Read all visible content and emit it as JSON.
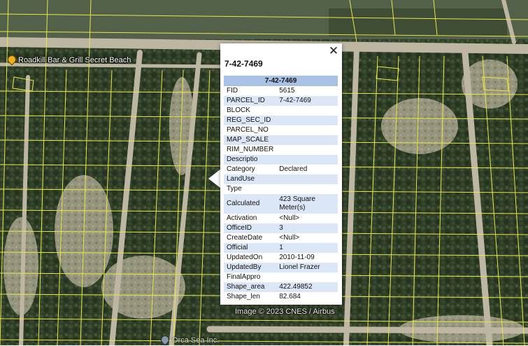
{
  "map": {
    "poi_label": "Roadkill Bar & Grill Secret Beach",
    "bottom_label": "Orca Sea Inc.",
    "attribution": "Image © 2023 CNES / Airbus",
    "parcel_line_color": "#e8e84a",
    "icons": [
      "poi-pin-icon",
      "location-pin-icon",
      "close-icon"
    ]
  },
  "popup": {
    "title": "7-42-7469",
    "table_header": "7-42-7469",
    "close_label": "✕",
    "rows": [
      {
        "key": "FID",
        "value": "5615"
      },
      {
        "key": "PARCEL_ID",
        "value": "7-42-7469"
      },
      {
        "key": "BLOCK",
        "value": ""
      },
      {
        "key": "REG_SEC_ID",
        "value": ""
      },
      {
        "key": "PARCEL_NO",
        "value": ""
      },
      {
        "key": "MAP_SCALE",
        "value": ""
      },
      {
        "key": "RIM_NUMBER",
        "value": ""
      },
      {
        "key": "Descriptio",
        "value": ""
      },
      {
        "key": "Category",
        "value": "Declared"
      },
      {
        "key": "LandUse",
        "value": ""
      },
      {
        "key": "Type",
        "value": ""
      },
      {
        "key": "Calculated",
        "value": "423 Square Meter(s)"
      },
      {
        "key": "Activation",
        "value": "<Null>"
      },
      {
        "key": "OfficeID",
        "value": "3"
      },
      {
        "key": "CreateDate",
        "value": "<Null>"
      },
      {
        "key": "Official",
        "value": "1"
      },
      {
        "key": "UpdatedOn",
        "value": "2010-11-09"
      },
      {
        "key": "UpdatedBy",
        "value": "Lionel Frazer"
      },
      {
        "key": "FinalAppro",
        "value": ""
      },
      {
        "key": "Shape_area",
        "value": "422.49852"
      },
      {
        "key": "Shape_len",
        "value": "82.684"
      }
    ]
  }
}
